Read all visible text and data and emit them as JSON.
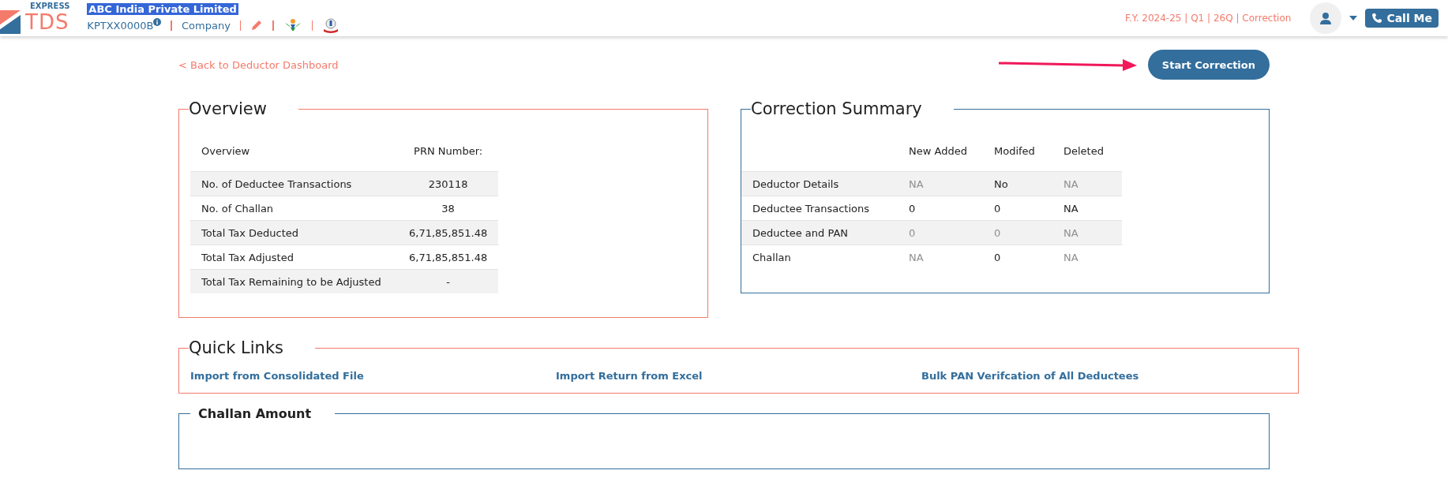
{
  "header": {
    "logo_top": "EXPRESS",
    "logo_main": "TDS",
    "company": "ABC India Private Limited",
    "tan": "KPTXX0000B",
    "entity_type": "Company",
    "period": "F.Y. 2024-25  | Q1  | 26Q | Correction",
    "call_button": "Call Me"
  },
  "back_link": "< Back to Deductor Dashboard",
  "start_button": "Start Correction",
  "overview": {
    "title": "Overview",
    "columns": [
      "Overview",
      "PRN Number:"
    ],
    "rows": [
      {
        "label": "No. of Deductee Transactions",
        "value": "230118"
      },
      {
        "label": "No. of Challan",
        "value": "38"
      },
      {
        "label": "Total Tax Deducted",
        "value": "6,71,85,851.48"
      },
      {
        "label": "Total Tax Adjusted",
        "value": "6,71,85,851.48"
      },
      {
        "label": "Total Tax Remaining to be Adjusted",
        "value": "-"
      }
    ]
  },
  "correction_summary": {
    "title": "Correction Summary",
    "columns": [
      "New Added",
      "Modifed",
      "Deleted"
    ],
    "rows": [
      {
        "label": "Deductor Details",
        "cells": [
          {
            "text": "NA",
            "disabled": true
          },
          {
            "text": "No",
            "disabled": false
          },
          {
            "text": "NA",
            "disabled": true
          }
        ]
      },
      {
        "label": "Deductee Transactions",
        "cells": [
          {
            "text": "0",
            "disabled": false
          },
          {
            "text": "0",
            "disabled": false
          },
          {
            "text": "NA",
            "disabled": false
          }
        ]
      },
      {
        "label": "Deductee and PAN",
        "cells": [
          {
            "text": "0",
            "disabled": true
          },
          {
            "text": "0",
            "disabled": true
          },
          {
            "text": "NA",
            "disabled": true
          }
        ]
      },
      {
        "label": "Challan",
        "cells": [
          {
            "text": "NA",
            "disabled": true
          },
          {
            "text": "0",
            "disabled": false
          },
          {
            "text": "NA",
            "disabled": true
          }
        ]
      }
    ]
  },
  "quick_links": {
    "title": "Quick Links",
    "links": [
      "Import from Consolidated File",
      "Import Return from Excel",
      "Bulk PAN Verifcation of All Deductees"
    ]
  },
  "challan_amount": {
    "title": "Challan Amount"
  }
}
